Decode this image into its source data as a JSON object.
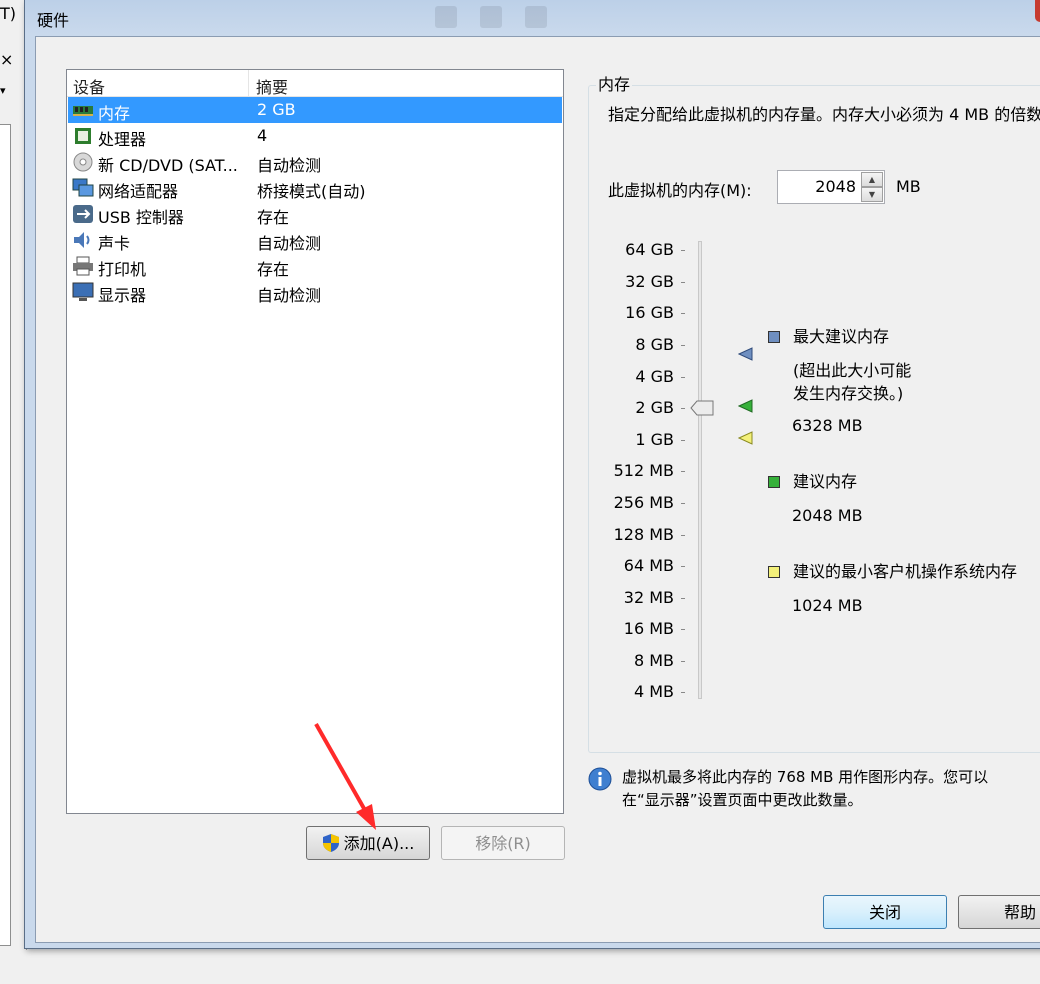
{
  "background": {
    "menu_fragment": "T)",
    "close_fragment": "×",
    "dropdown_fragment": "▾"
  },
  "window": {
    "title": "硬件"
  },
  "device_list": {
    "headers": {
      "device": "设备",
      "summary": "摘要"
    },
    "rows": [
      {
        "device": "内存",
        "summary": "2 GB",
        "icon": "memory-icon",
        "selected": true
      },
      {
        "device": "处理器",
        "summary": "4",
        "icon": "processor-icon"
      },
      {
        "device": "新 CD/DVD (SAT...",
        "summary": "自动检测",
        "icon": "cd-dvd-icon"
      },
      {
        "device": "网络适配器",
        "summary": "桥接模式(自动)",
        "icon": "network-adapter-icon"
      },
      {
        "device": "USB 控制器",
        "summary": "存在",
        "icon": "usb-icon"
      },
      {
        "device": "声卡",
        "summary": "自动检测",
        "icon": "sound-card-icon"
      },
      {
        "device": "打印机",
        "summary": "存在",
        "icon": "printer-icon"
      },
      {
        "device": "显示器",
        "summary": "自动检测",
        "icon": "display-icon"
      }
    ]
  },
  "buttons": {
    "add": "添加(A)...",
    "remove": "移除(R)",
    "close": "关闭",
    "help": "帮助"
  },
  "memory": {
    "group_title": "内存",
    "description": "指定分配给此虚拟机的内存量。内存大小必须为 4 MB 的倍数。",
    "label": "此虚拟机的内存(M):",
    "value": "2048",
    "unit": "MB",
    "scale_labels": [
      "64 GB",
      "32 GB",
      "16 GB",
      "8 GB",
      "4 GB",
      "2 GB",
      "1 GB",
      "512 MB",
      "256 MB",
      "128 MB",
      "64 MB",
      "32 MB",
      "16 MB",
      "8 MB",
      "4 MB"
    ],
    "current": "2 GB",
    "legend": {
      "max": {
        "title": "最大建议内存",
        "note_line1": "(超出此大小可能",
        "note_line2": "发生内存交换。)",
        "value": "6328 MB",
        "color": "#6f8fc0"
      },
      "recommended": {
        "title": "建议内存",
        "value": "2048 MB",
        "color": "#36b03a"
      },
      "min_guest": {
        "title": "建议的最小客户机操作系统内存",
        "value": "1024 MB",
        "color": "#f3f07a"
      }
    }
  },
  "info": {
    "line1": "虚拟机最多将此内存的 768 MB 用作图形内存。您可以",
    "line2": "在“显示器”设置页面中更改此数量。"
  }
}
